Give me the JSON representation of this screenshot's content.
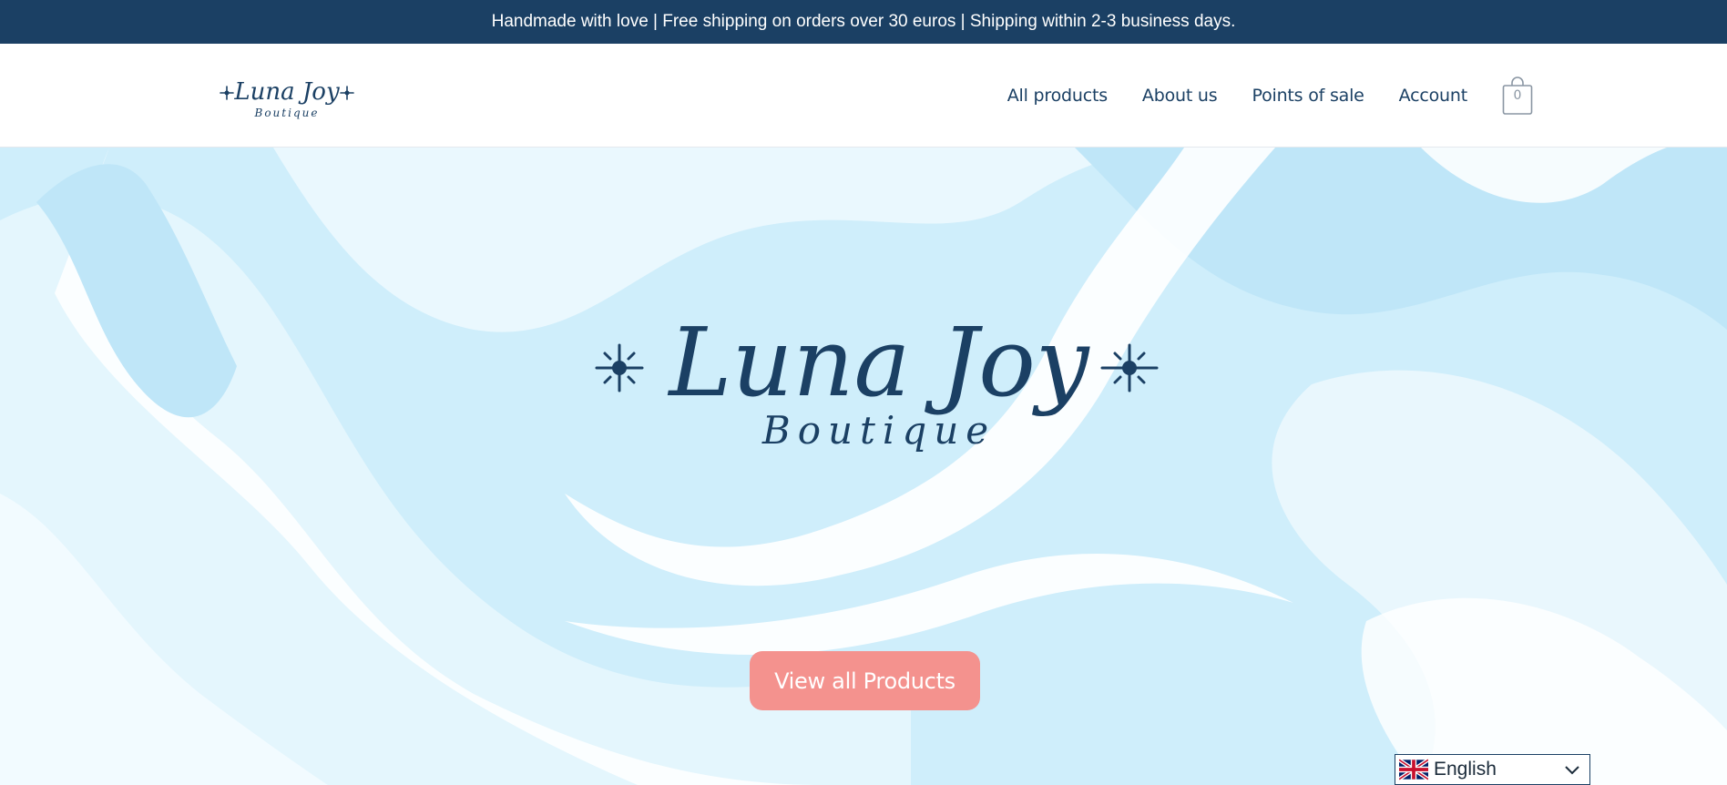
{
  "announcement": {
    "text": "Handmade with love | Free shipping on orders over 30 euros | Shipping within 2-3 business days."
  },
  "header": {
    "logo": {
      "title": "Luna Joy",
      "subtitle": "Boutique"
    },
    "nav": [
      {
        "label": "All products"
      },
      {
        "label": "About us"
      },
      {
        "label": "Points of sale"
      },
      {
        "label": "Account"
      }
    ],
    "cart": {
      "count": "0",
      "icon": "shopping-bag-icon"
    }
  },
  "hero": {
    "logo": {
      "title": "Luna Joy",
      "subtitle": "Boutique"
    },
    "cta_label": "View all Products"
  },
  "language": {
    "selected": "English",
    "flag_icon": "uk-flag-icon",
    "chevron_icon": "chevron-down-icon"
  },
  "colors": {
    "brand_navy": "#1b4064",
    "cta_coral": "#f4928e",
    "hero_light_blue": "#cfeefb"
  }
}
